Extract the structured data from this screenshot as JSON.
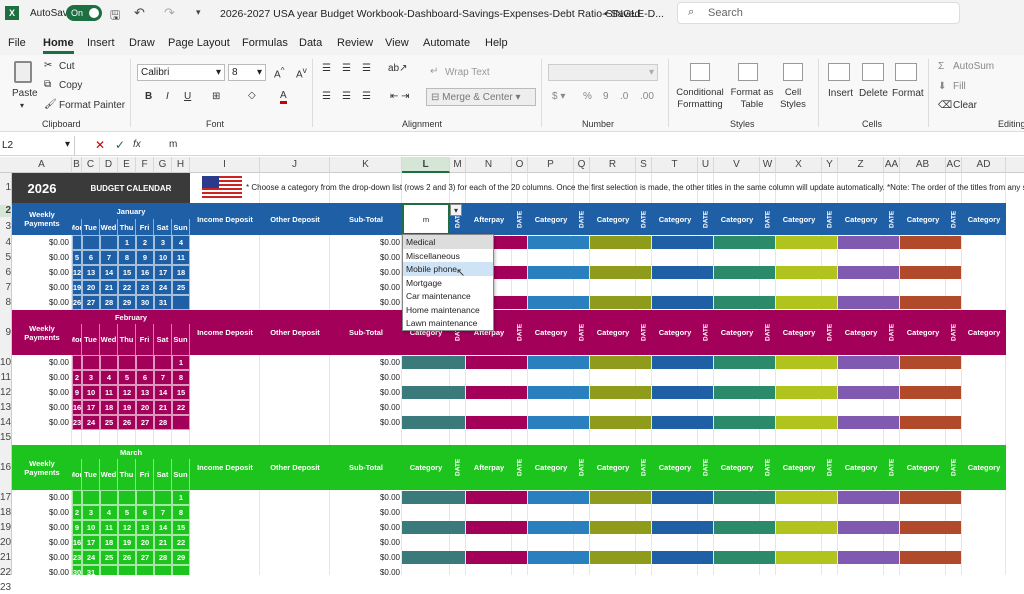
{
  "titlebar": {
    "autosave": "AutoSave",
    "toggle": "On",
    "filename": "2026-2027 USA year Budget Workbook-Dashboard-Savings-Expenses-Debt Ratio-SINGLE-D...",
    "saved": "• Saved",
    "search": "Search"
  },
  "menu": [
    "File",
    "Home",
    "Insert",
    "Draw",
    "Page Layout",
    "Formulas",
    "Data",
    "Review",
    "View",
    "Automate",
    "Help"
  ],
  "ribbon": {
    "paste": "Paste",
    "cut": "Cut",
    "copy": "Copy",
    "format_painter": "Format Painter",
    "clipboard": "Clipboard",
    "font_name": "Calibri",
    "font_size": "8",
    "font": "Font",
    "wrap": "Wrap Text",
    "merge": "Merge & Center",
    "alignment": "Alignment",
    "number": "Number",
    "cond": "Conditional Formatting",
    "format_table": "Format as Table",
    "cell_styles": "Cell Styles",
    "styles": "Styles",
    "insert": "Insert",
    "delete": "Delete",
    "format": "Format",
    "cells": "Cells",
    "autosum": "AutoSum",
    "fill": "Fill",
    "clear": "Clear",
    "editing": "Editing"
  },
  "formula": {
    "namebox": "L2",
    "fx": "fx",
    "value": "m"
  },
  "columns": [
    "A",
    "B",
    "C",
    "D",
    "E",
    "F",
    "G",
    "H",
    "I",
    "J",
    "K",
    "L",
    "M",
    "N",
    "O",
    "P",
    "Q",
    "R",
    "S",
    "T",
    "U",
    "V",
    "W",
    "X",
    "Y",
    "Z",
    "AA",
    "AB",
    "AC",
    "AD"
  ],
  "rows": [
    "1",
    "2",
    "3",
    "4",
    "5",
    "6",
    "7",
    "8",
    "9",
    "10",
    "11",
    "12",
    "13",
    "14",
    "15",
    "16",
    "17",
    "18",
    "19",
    "20",
    "21",
    "22",
    "23"
  ],
  "sheet": {
    "year": "2026",
    "calendar_title": "BUDGET CALENDAR",
    "note": "* Choose a category from the drop-down list (rows 2 and 3) for each of the 20 columns. Once the first selection is made, the other titles in the same column will update automatically. *Note: The order of the titles from any she",
    "weekly": "Weekly Payments",
    "income": "Income Deposit",
    "other": "Other Deposit",
    "subtotal": "Sub-Total",
    "category": "Category",
    "date": "DATE",
    "afterpay": "Afterpay",
    "zero": "$0.00",
    "input": "m",
    "days": [
      "Mon",
      "Tue",
      "Wed",
      "Thu",
      "Fri",
      "Sat",
      "Sun"
    ],
    "months": [
      {
        "name": "January",
        "weeks": [
          [
            "",
            "",
            "",
            "1",
            "2",
            "3",
            "4"
          ],
          [
            "5",
            "6",
            "7",
            "8",
            "9",
            "10",
            "11"
          ],
          [
            "12",
            "13",
            "14",
            "15",
            "16",
            "17",
            "18"
          ],
          [
            "19",
            "20",
            "21",
            "22",
            "23",
            "24",
            "25"
          ],
          [
            "26",
            "27",
            "28",
            "29",
            "30",
            "31",
            ""
          ]
        ]
      },
      {
        "name": "February",
        "weeks": [
          [
            "",
            "",
            "",
            "",
            "",
            "",
            "1"
          ],
          [
            "2",
            "3",
            "4",
            "5",
            "6",
            "7",
            "8"
          ],
          [
            "9",
            "10",
            "11",
            "12",
            "13",
            "14",
            "15"
          ],
          [
            "16",
            "17",
            "18",
            "19",
            "20",
            "21",
            "22"
          ],
          [
            "23",
            "24",
            "25",
            "26",
            "27",
            "28",
            ""
          ]
        ]
      },
      {
        "name": "March",
        "weeks": [
          [
            "",
            "",
            "",
            "",
            "",
            "",
            "1"
          ],
          [
            "2",
            "3",
            "4",
            "5",
            "6",
            "7",
            "8"
          ],
          [
            "9",
            "10",
            "11",
            "12",
            "13",
            "14",
            "15"
          ],
          [
            "16",
            "17",
            "18",
            "19",
            "20",
            "21",
            "22"
          ],
          [
            "23",
            "24",
            "25",
            "26",
            "27",
            "28",
            "29"
          ],
          [
            "30",
            "31",
            "",
            "",
            "",
            "",
            ""
          ]
        ]
      }
    ],
    "dropdown": [
      "Medical",
      "Miscellaneous",
      "Mobile phone",
      "Mortgage",
      "Car maintenance",
      "Home maintenance",
      "Lawn maintenance"
    ],
    "colors": {
      "jan": "#1f5fa6",
      "feb": "#a3005a",
      "mar": "#1dc41d",
      "dark": "#3a3a3a"
    }
  }
}
